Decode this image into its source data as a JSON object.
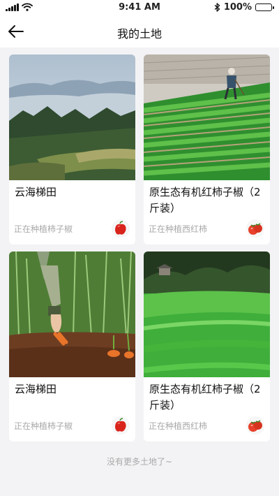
{
  "status_bar": {
    "time": "9:41 AM",
    "battery": "100%"
  },
  "header": {
    "title": "我的土地"
  },
  "lands": [
    {
      "name": "云海梯田",
      "crop_status": "正在种植柿子椒",
      "image": "terraced-fields-photo",
      "crop_icon": "bell-pepper-icon"
    },
    {
      "name": "原生态有机红柿子椒（2斤装）",
      "crop_status": "正在种植西红柿",
      "image": "farmer-in-field-photo",
      "crop_icon": "tomato-icon"
    },
    {
      "name": "云海梯田",
      "crop_status": "正在种植柿子椒",
      "image": "carrot-harvest-photo",
      "crop_icon": "bell-pepper-icon"
    },
    {
      "name": "原生态有机红柿子椒（2斤装）",
      "crop_status": "正在种植西红柿",
      "image": "green-field-photo",
      "crop_icon": "tomato-icon"
    }
  ],
  "footer": {
    "no_more_text": "没有更多土地了~"
  },
  "colors": {
    "background": "#f3f3f5",
    "card": "#ffffff",
    "muted_text": "#a9a9a9",
    "pepper_red": "#d9241c",
    "tomato_red": "#e8412c"
  }
}
